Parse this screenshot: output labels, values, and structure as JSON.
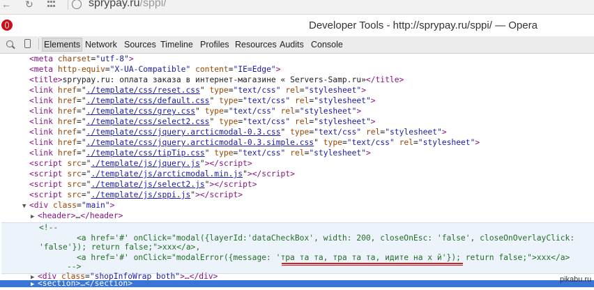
{
  "browser": {
    "url_host": "sprypay.ru",
    "url_path": "/sppi/"
  },
  "window": {
    "title": "Developer Tools - http://sprypay.ru/sppi/ — Opera"
  },
  "devtools": {
    "tabs": [
      "Elements",
      "Network",
      "Sources",
      "Timeline",
      "Profiles",
      "Resources",
      "Audits",
      "Console"
    ],
    "active_tab": "Elements"
  },
  "code": {
    "meta_charset": {
      "open": "<meta ",
      "attr": "charset",
      "val": "\"utf-8\"",
      "close": ">"
    },
    "meta_compat": {
      "open": "<meta ",
      "attr1": "http-equiv",
      "val1": "\"X-UA-Compatible\"",
      "attr2": " content",
      "val2": "\"IE=Edge\"",
      "close": ">"
    },
    "title": {
      "open": "<title>",
      "text": "sprypay.ru: оплата заказа в интернет-магазине « Servers-Samp.ru»",
      "close": "</title>"
    },
    "links": [
      {
        "href": "./template/css/reset.css",
        "rest_type": "\"text/css\"",
        "rest_rel": "\"stylesheet\""
      },
      {
        "href": "./template/css/default.css",
        "rest_type": "\"text/css\"",
        "rest_rel": "\"stylesheet\""
      },
      {
        "href": "./template/css/grey.css",
        "rest_type": "\"text/css\"",
        "rest_rel": "\"stylesheet\""
      },
      {
        "href": "./template/css/select2.css",
        "rest_type": "\"text/css\"",
        "rest_rel": "\"stylesheet\""
      },
      {
        "href": "./template/css/jquery.arcticmodal-0.3.css",
        "rest_type": "\"text/css\"",
        "rest_rel": "\"stylesheet\""
      },
      {
        "href": "./template/css/jquery.arcticmodal-0.3.simple.css",
        "rest_type": "\"text/css\"",
        "rest_rel": "\"stylesheet\""
      },
      {
        "href": "./template/css/tipTip.css",
        "rest_type": "\"text/css\"",
        "rest_rel": "\"stylesheet\""
      }
    ],
    "scripts": [
      "./template/js/jquery.js",
      "./template/js/arcticmodal.min.js",
      "./template/js/select2.js",
      "./template/js/sppi.js"
    ],
    "div_main": {
      "open": "<div ",
      "attr": "class",
      "val": "\"main\"",
      "close": ">"
    },
    "header": {
      "open": "<header>",
      "ellipsis": "…",
      "close": "</header>"
    },
    "comment_open": "<!--",
    "comment_line1": "<a href='#' onClick=\"modal({layerId:'dataCheckBox', width: 200, closeOnEsc: 'false', closeOnOverlayClick:",
    "comment_line2": "'false'}); return false;\">xxx</a>,",
    "comment_line3a": "<a href='#' onClick=\"modalError({message: ",
    "comment_line3b": "'тра та та, тра та та, идите на х й'",
    "comment_line3c": "}); return false;\">xxx</a>",
    "comment_close": "-->",
    "div_shop": {
      "open": "<div ",
      "attr": "class",
      "val": "\"shopInfoWrap both\"",
      "tail": ">…</div>"
    },
    "section": "<section>…</section>"
  },
  "watermark": "pikabu.ru"
}
